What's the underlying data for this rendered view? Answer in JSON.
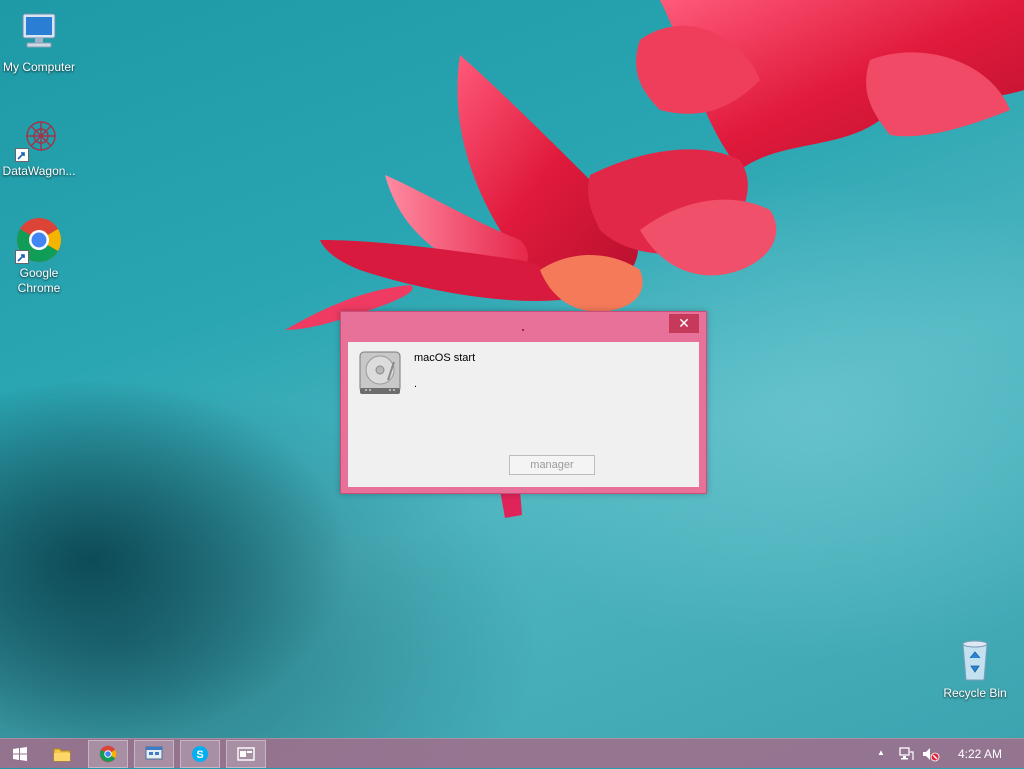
{
  "desktop": {
    "icons": [
      {
        "label": "My Computer",
        "icon": "computer-icon"
      },
      {
        "label": "DataWagon...",
        "icon": "datawagon-icon"
      },
      {
        "label": "Google Chrome",
        "icon": "chrome-icon"
      },
      {
        "label": "Recycle Bin",
        "icon": "recycle-bin-icon"
      }
    ]
  },
  "dialog": {
    "message": "macOS start",
    "message_line2": ".",
    "button_label": "manager",
    "close_glyph": "✕",
    "icon": "hard-drive-icon",
    "frame_color": "#e8719a"
  },
  "taskbar": {
    "items": [
      {
        "name": "start",
        "icon": "windows-logo-icon"
      },
      {
        "name": "file-explorer",
        "icon": "folder-icon"
      },
      {
        "name": "chrome",
        "icon": "chrome-icon",
        "active": true
      },
      {
        "name": "network-app",
        "icon": "network-window-icon",
        "active": true
      },
      {
        "name": "skype",
        "icon": "skype-icon",
        "active": true
      },
      {
        "name": "window-app",
        "icon": "window-icon",
        "active": true
      }
    ],
    "tray": {
      "up_arrow": "▲",
      "network_icon": "network-icon",
      "volume_icon": "volume-muted-icon",
      "time": "4:22 AM"
    }
  }
}
